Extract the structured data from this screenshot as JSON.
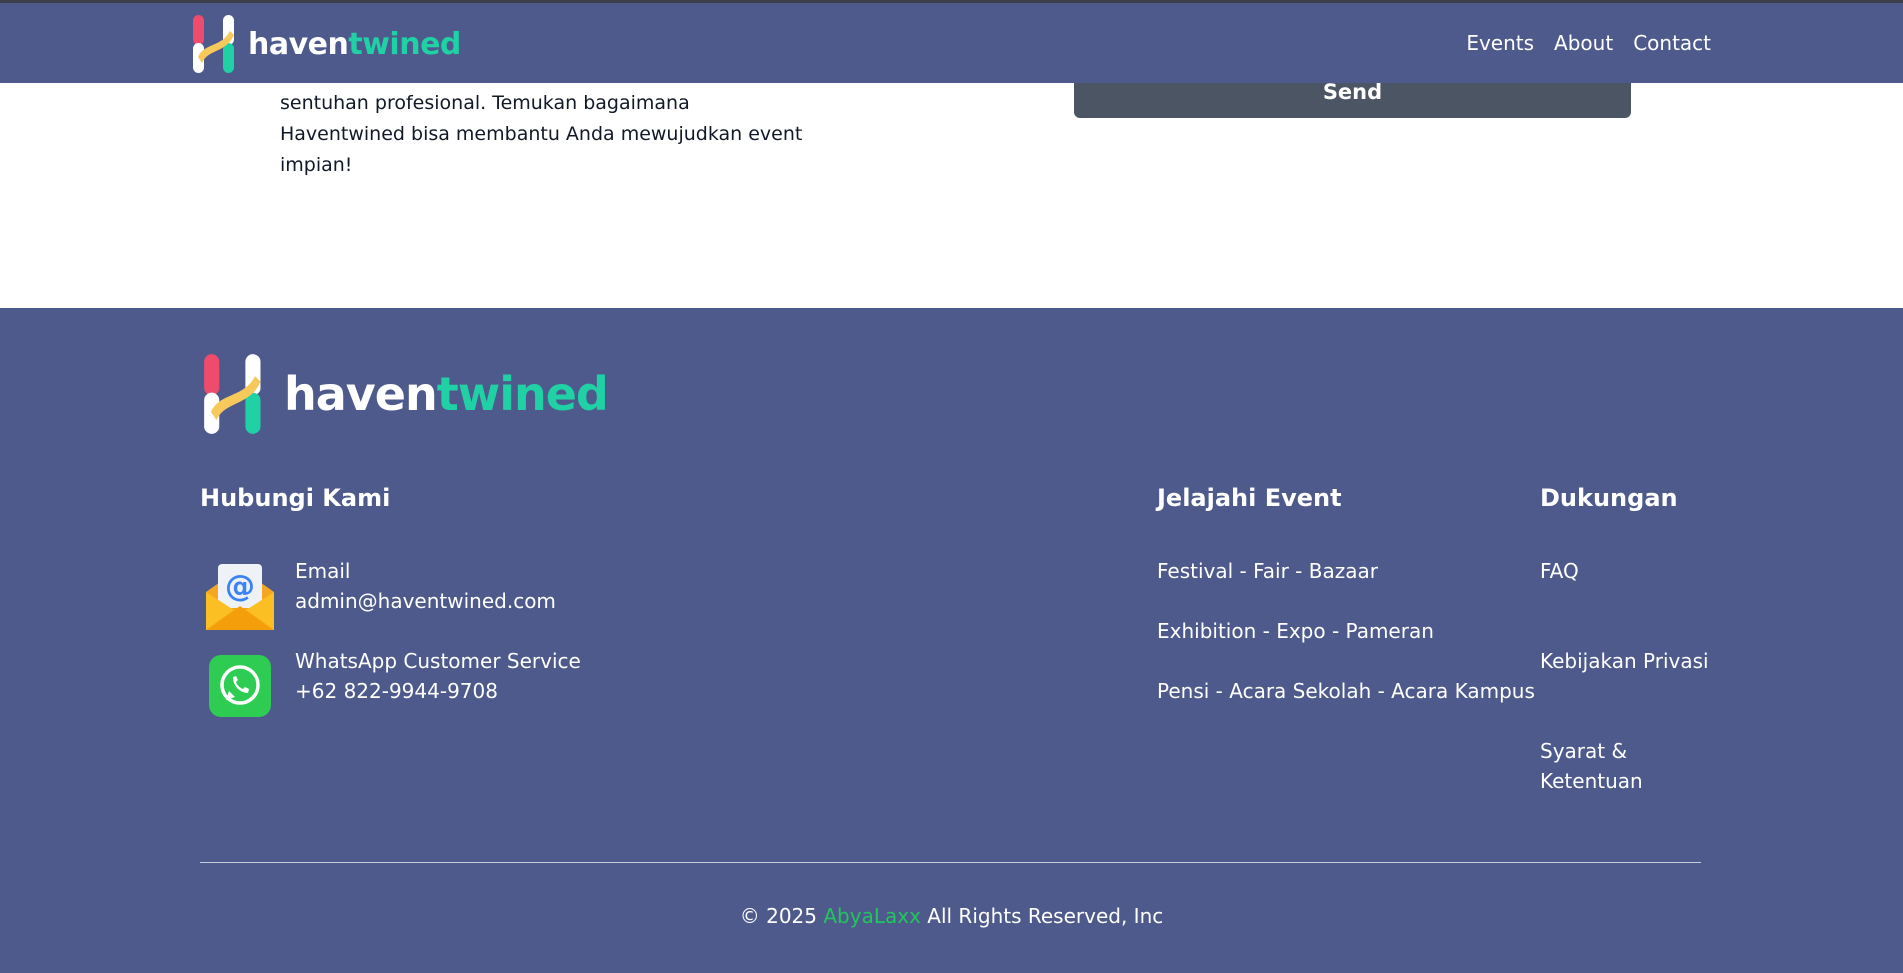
{
  "navbar": {
    "brand_part1": "haven",
    "brand_part2": "twined",
    "links": [
      "Events",
      "About",
      "Contact"
    ]
  },
  "intro": {
    "text": "sentuhan profesional. Temukan bagaimana Haventwined bisa membantu Anda mewujudkan event impian!"
  },
  "form": {
    "send_label": "Send"
  },
  "footer": {
    "brand_part1": "haven",
    "brand_part2": "twined",
    "contact": {
      "title": "Hubungi Kami",
      "email_label": "Email",
      "email_value": "admin@haventwined.com",
      "whatsapp_label": "WhatsApp Customer Service",
      "whatsapp_value": "+62 822-9944-9708"
    },
    "explore": {
      "title": "Jelajahi Event",
      "links": [
        "Festival - Fair - Bazaar",
        "Exhibition - Expo - Pameran",
        "Pensi - Acara Sekolah - Acara Kampus"
      ]
    },
    "support": {
      "title": "Dukungan",
      "links": [
        "FAQ",
        "Kebijakan Privasi",
        "Syarat & Ketentuan"
      ]
    },
    "copyright": {
      "prefix": "© 2025",
      "brand": "AbyaLaxx",
      "suffix": "All Rights Reserved, Inc"
    }
  },
  "colors": {
    "navbar_bg": "#4e5a8b",
    "footer_bg": "#4e5a8b",
    "brand_green": "#1fd1a5",
    "copyright_green": "#22c55e",
    "button_bg": "#4b5563"
  },
  "icons": [
    "haventwined-logo-icon",
    "email-envelope-icon",
    "whatsapp-icon"
  ]
}
